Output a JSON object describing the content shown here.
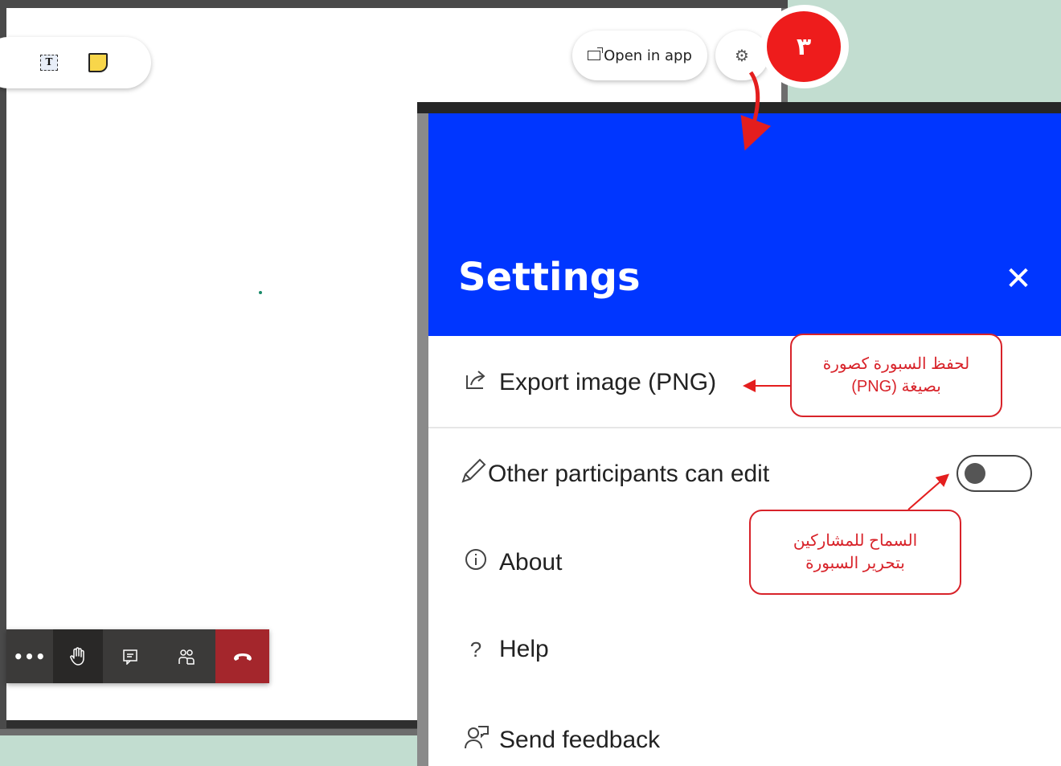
{
  "whiteboard": {
    "toolbar": {
      "text_tool": "T",
      "note_tool": "sticky-note"
    },
    "open_in_app_label": "Open in app",
    "settings_icon": "gear-icon"
  },
  "meeting_controls": {
    "more_label": "•••",
    "icons": [
      "more-icon",
      "raise-hand-icon",
      "chat-icon",
      "participants-icon",
      "hang-up-icon"
    ],
    "hangup_color": "#a4262c"
  },
  "step_badge": {
    "number": "٣",
    "color": "#ee1c1c"
  },
  "settings_panel": {
    "title": "Settings",
    "close_label": "✕",
    "header_color": "#0036ff",
    "items": [
      {
        "label": "Export image (PNG)",
        "icon": "export-icon"
      },
      {
        "label": "Other participants can edit",
        "icon": "pencil-icon",
        "toggle": "off"
      },
      {
        "label": "About",
        "icon": "info-icon"
      },
      {
        "label": "Help",
        "icon": "help-icon"
      },
      {
        "label": "Send feedback",
        "icon": "feedback-icon"
      }
    ]
  },
  "callouts": {
    "export_line1": "لحفظ السبورة كصورة",
    "export_line2": "بصيغة (PNG)",
    "edit_line1": "السماح للمشاركين",
    "edit_line2": "بتحرير السبورة"
  }
}
